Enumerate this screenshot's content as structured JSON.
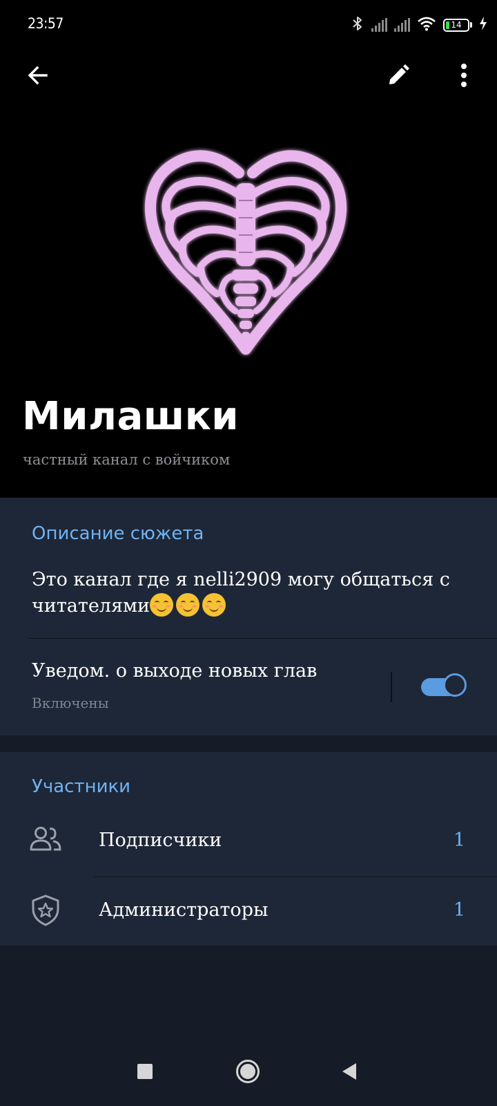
{
  "status_bar": {
    "time": "23:57",
    "battery_level": "14",
    "icons": [
      "bluetooth-icon",
      "signal-icon",
      "signal-icon",
      "wifi-icon",
      "battery-icon",
      "charging-icon"
    ]
  },
  "toolbar": {
    "back_icon": "arrow-left-icon",
    "edit_icon": "pencil-icon",
    "menu_icon": "more-vertical-icon"
  },
  "channel": {
    "title": "Милашки",
    "subtitle": "частный канал с войчиком",
    "avatar": "heart-ribcage-image"
  },
  "description": {
    "section_title": "Описание сюжета",
    "text": "Это канал где я nelli2909  могу общаться с читателями",
    "emoji_count": 3
  },
  "notifications": {
    "title": "Уведом. о выходе новых глав",
    "status": "Включены",
    "enabled": true
  },
  "members": {
    "section_title": "Участники",
    "rows": [
      {
        "label": "Подписчики",
        "count": "1",
        "icon": "users-icon"
      },
      {
        "label": "Администраторы",
        "count": "1",
        "icon": "shield-star-icon"
      }
    ]
  },
  "nav_bar": {
    "buttons": [
      "recents-square-icon",
      "home-circle-icon",
      "back-triangle-icon"
    ]
  },
  "colors": {
    "header_bg": "#000000",
    "card_bg": "#1e2737",
    "page_bg": "#151c27",
    "accent": "#6fb3f2",
    "toggle": "#5b9be0",
    "avatar_tint": "#e8b6ec"
  }
}
